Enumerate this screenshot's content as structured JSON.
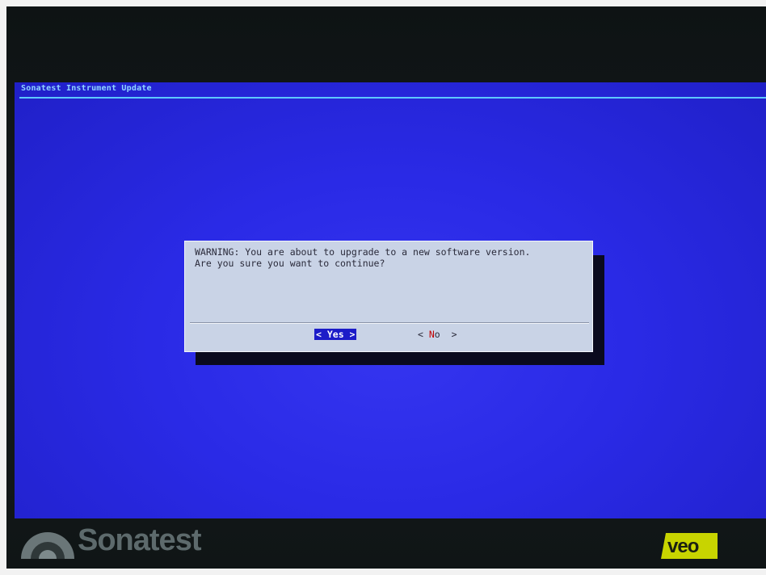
{
  "window": {
    "title": "Sonatest Instrument Update"
  },
  "dialog": {
    "message_line1": "WARNING: You are about to upgrade to a new software version.",
    "message_line2": "Are you sure you want to continue?",
    "yes_label": "< Yes >",
    "no_left": "< ",
    "no_hotkey": "N",
    "no_rest": "o  >",
    "selected": "yes"
  },
  "device": {
    "brand": "Sonatest",
    "badge": "veo"
  },
  "colors": {
    "screen_bg": "#2a2ae6",
    "title_text": "#8fd6ff",
    "dialog_bg": "#c9d3e6",
    "selected_button_bg": "#1c1cc8",
    "hotkey": "#c00000"
  }
}
